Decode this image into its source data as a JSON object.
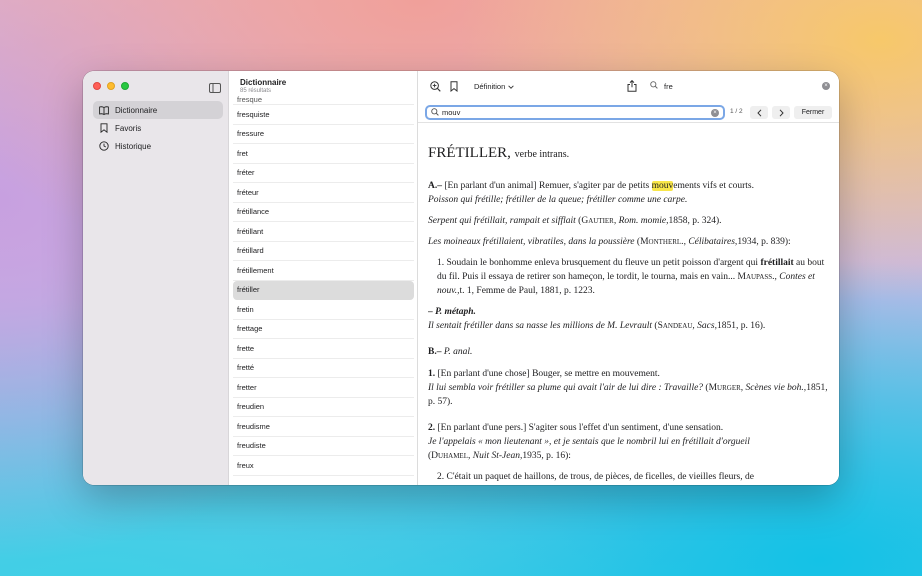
{
  "sidebar": {
    "items": [
      {
        "label": "Dictionnaire",
        "icon": "book-icon",
        "selected": true
      },
      {
        "label": "Favoris",
        "icon": "bookmark-icon",
        "selected": false
      },
      {
        "label": "Historique",
        "icon": "clock-icon",
        "selected": false
      }
    ]
  },
  "wordlist": {
    "title": "Dictionnaire",
    "count": "85 résultats",
    "partial_first": "fresque",
    "items": [
      "fresquiste",
      "fressure",
      "fret",
      "fréter",
      "fréteur",
      "frétillance",
      "frétillant",
      "frétillard",
      "frétillement",
      "frétiller",
      "fretin",
      "frettage",
      "frette",
      "fretté",
      "fretter",
      "freudien",
      "freudisme",
      "freudiste",
      "freux"
    ],
    "selected": "frétiller"
  },
  "toolbar": {
    "mode_label": "Définition",
    "search_value": "fre"
  },
  "findbar": {
    "query": "mouv",
    "count": "1 / 2",
    "close_label": "Fermer"
  },
  "entry": {
    "headword": "FRÉTILLER,",
    "grammar": "verbe intrans.",
    "a_label": "A.–",
    "a_def_pre": "[En parlant d'un animal] Remuer, s'agiter par de petits ",
    "a_def_hl": "mouv",
    "a_def_post": "ements vifs et courts.",
    "a_ex1": "Poisson qui frétille; frétiller de la queue; frétiller comme une carpe.",
    "q1_text": "Serpent qui frétillait, rampait et sifflait",
    "q1_author": "Gautier",
    "q1_ref": ", Rom. momie,",
    "q1_tail": "1858, p. 324).",
    "q2_text": "Les moineaux frétillaient, vibratiles, dans la poussière",
    "q2_author": "Montherl.",
    "q2_ref": ", Célibataires,",
    "q2_tail": "1934, p. 839):",
    "c1_pre": "1. Soudain le bonhomme enleva brusquement du fleuve un petit poisson d'argent qui ",
    "c1_bold": "frétillait",
    "c1_mid": " au bout du fil. Puis il essaya de retirer son hameçon, le tordit, le tourna, mais en vain... ",
    "c1_author": "Maupass.",
    "c1_ref": ", Contes et nouv.,",
    "c1_tail": "t. 1, Femme de Paul, 1881, p. 1223.",
    "metaph_label": "– P. métaph.",
    "metaph_text": "Il sentait frétiller dans sa nasse les millions de M. Levrault",
    "metaph_author": "Sandeau",
    "metaph_ref": ", Sacs,",
    "metaph_tail": "1851, p. 16).",
    "b_label": "B.–",
    "b_sub": "P. anal.",
    "b1_num": "1.",
    "b1_def": " [En parlant d'une chose] Bouger, se mettre en mouvement.",
    "b1_ex": "Il lui sembla voir frétiller sa plume qui avait l'air de lui dire : Travaille?",
    "b1_author": "Murger",
    "b1_ref": ", Scènes vie boh.,",
    "b1_tail": "1851, p. 57).",
    "b2_num": "2.",
    "b2_def": " [En parlant d'une pers.] S'agiter sous l'effet d'un sentiment, d'une sensation.",
    "b2_ex": "Je l'appelais « mon lieutenant », et je sentais que le nombril lui en frétillait d'orgueil",
    "b2_author": "Duhamel",
    "b2_ref": ", Nuit St-Jean,",
    "b2_tail": "1935, p. 16):",
    "c2_text": "2. C'était un paquet de haillons, de trous, de pièces, de ficelles, de vieilles fleurs, de"
  }
}
